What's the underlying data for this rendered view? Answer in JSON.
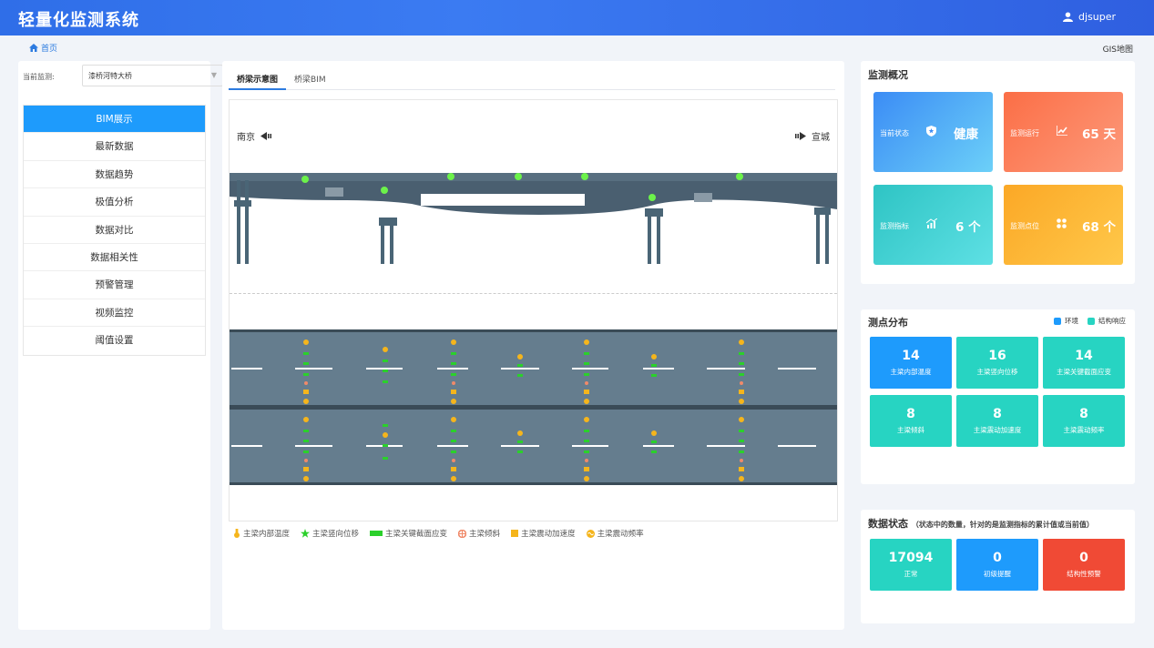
{
  "header": {
    "title": "轻量化监测系统",
    "user": "djsuper"
  },
  "breadcrumb": {
    "home": "首页",
    "gis": "GIS地图"
  },
  "left": {
    "select_label": "当前监测:",
    "select_value": "漆桥河特大桥",
    "menu": [
      {
        "label": "BIM展示",
        "active": true
      },
      {
        "label": "最新数据"
      },
      {
        "label": "数据趋势"
      },
      {
        "label": "极值分析"
      },
      {
        "label": "数据对比"
      },
      {
        "label": "数据相关性"
      },
      {
        "label": "预警管理"
      },
      {
        "label": "视频监控"
      },
      {
        "label": "阈值设置"
      }
    ]
  },
  "center": {
    "tabs": [
      "桥梁示意图",
      "桥梁BIM"
    ],
    "dir_left": "南京",
    "dir_right": "宣城",
    "legend": [
      "主梁内部温度",
      "主梁竖向位移",
      "主梁关键截面应变",
      "主梁倾斜",
      "主梁震动加速度",
      "主梁震动频率"
    ]
  },
  "overview": {
    "title": "监测概况",
    "cards": [
      {
        "label": "当前状态",
        "value": "健康",
        "icon": "shield-icon",
        "color_from": "#3b8cf5",
        "color_to": "#6cd0f8"
      },
      {
        "label": "监测运行",
        "value": "65 天",
        "icon": "chart-icon",
        "color_from": "#fb6e46",
        "color_to": "#fd9a7b"
      },
      {
        "label": "监测指标",
        "value": "6 个",
        "icon": "trend-icon",
        "color_from": "#2ec4c4",
        "color_to": "#5ee0e4"
      },
      {
        "label": "监测点位",
        "value": "68 个",
        "icon": "grid-icon",
        "color_from": "#fba826",
        "color_to": "#ffc84a"
      }
    ]
  },
  "distribution": {
    "title": "测点分布",
    "legend": [
      {
        "label": "环境",
        "color": "#1e9bfc"
      },
      {
        "label": "结构响应",
        "color": "#27d4c2"
      }
    ],
    "tiles": [
      {
        "value": "14",
        "label": "主梁内部温度",
        "color": "#1e9bfc"
      },
      {
        "value": "16",
        "label": "主梁竖向位移",
        "color": "#27d4c2"
      },
      {
        "value": "14",
        "label": "主梁关键截面应变",
        "color": "#27d4c2"
      },
      {
        "value": "8",
        "label": "主梁倾斜",
        "color": "#27d4c2"
      },
      {
        "value": "8",
        "label": "主梁震动加速度",
        "color": "#27d4c2"
      },
      {
        "value": "8",
        "label": "主梁震动频率",
        "color": "#27d4c2"
      }
    ]
  },
  "data_status": {
    "title": "数据状态",
    "note": "（状态中的数量，针对的是监测指标的累计值或当前值）",
    "tiles": [
      {
        "value": "17094",
        "label": "正常",
        "color": "#27d4c2"
      },
      {
        "value": "0",
        "label": "初级提醒",
        "color": "#1e9bfc"
      },
      {
        "value": "0",
        "label": "结构性预警",
        "color": "#f04a35"
      }
    ]
  }
}
